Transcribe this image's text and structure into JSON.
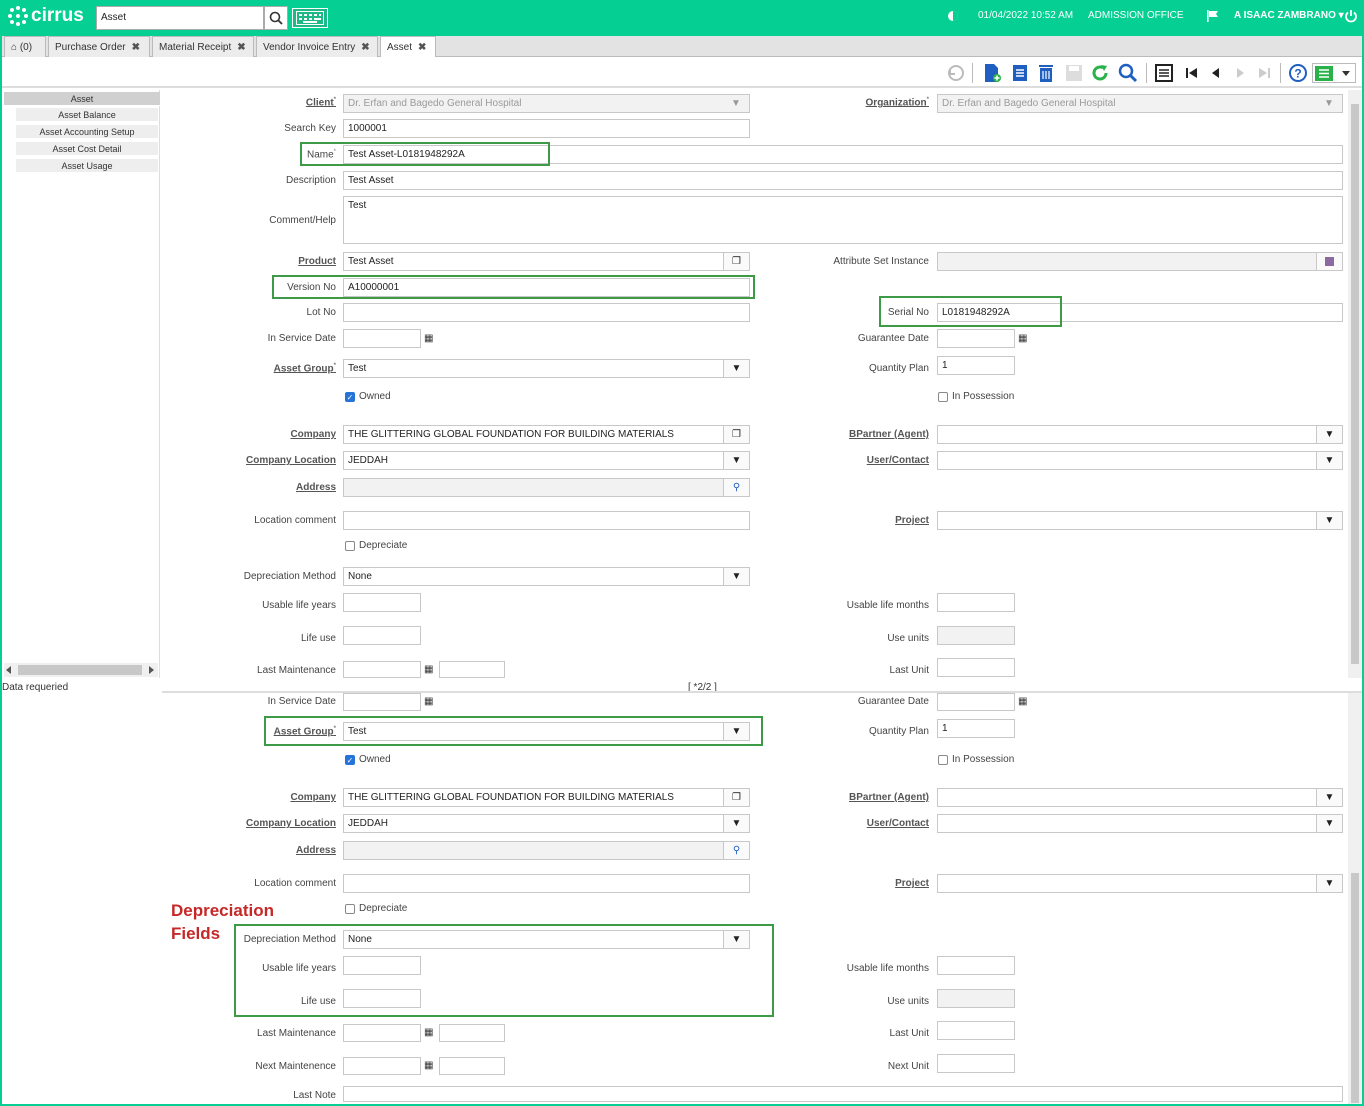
{
  "header": {
    "logo_text": "cirrus",
    "search_value": "Asset",
    "datetime": "01/04/2022 10:52 AM",
    "office": "ADMISSION OFFICE",
    "user": "A ISAAC ZAMBRANO ▾"
  },
  "tabs": [
    {
      "label": "(0)"
    },
    {
      "label": "Purchase Order"
    },
    {
      "label": "Material Receipt"
    },
    {
      "label": "Vendor Invoice Entry"
    },
    {
      "label": "Asset"
    }
  ],
  "nav": {
    "items": [
      {
        "label": "Asset"
      },
      {
        "label": "Asset Balance"
      },
      {
        "label": "Asset Accounting Setup"
      },
      {
        "label": "Asset Cost Detail"
      },
      {
        "label": "Asset Usage"
      }
    ],
    "status": "Data requeried",
    "record_info": "[ *2/2 ]"
  },
  "form": {
    "client_label": "Client",
    "client_value": "Dr. Erfan and Bagedo General Hospital",
    "org_label": "Organization",
    "org_value": "Dr. Erfan and Bagedo General Hospital",
    "search_key_label": "Search Key",
    "search_key_value": "1000001",
    "name_label": "Name",
    "name_value": "Test Asset-L0181948292A",
    "description_label": "Description",
    "description_value": "Test Asset",
    "comment_label": "Comment/Help",
    "comment_value": "Test",
    "product_label": "Product",
    "product_value": "Test Asset",
    "attr_set_label": "Attribute Set Instance",
    "version_label": "Version No",
    "version_value": "A10000001",
    "lot_label": "Lot No",
    "serial_label": "Serial No",
    "serial_value": "L0181948292A",
    "in_service_label": "In Service Date",
    "guarantee_label": "Guarantee Date",
    "asset_group_label": "Asset Group",
    "asset_group_value": "Test",
    "quantity_plan_label": "Quantity Plan",
    "quantity_plan_value": "1",
    "owned_label": "Owned",
    "in_possession_label": "In Possession",
    "company_label": "Company",
    "company_value": "THE GLITTERING GLOBAL FOUNDATION FOR BUILDING MATERIALS",
    "bpartner_label": "BPartner (Agent)",
    "company_location_label": "Company Location",
    "company_location_value": "JEDDAH",
    "user_contact_label": "User/Contact",
    "address_label": "Address",
    "location_comment_label": "Location comment",
    "project_label": "Project",
    "depreciate_label": "Depreciate",
    "depr_method_label": "Depreciation Method",
    "depr_method_value": "None",
    "usable_years_label": "Usable life years",
    "usable_months_label": "Usable life months",
    "life_use_label": "Life use",
    "use_units_label": "Use units",
    "last_maint_label": "Last Maintenance",
    "last_unit_label": "Last Unit",
    "next_maint_label": "Next Maintenence",
    "next_unit_label": "Next Unit",
    "last_note_label": "Last Note"
  },
  "annotation": {
    "depreciation_title": "Depreciation",
    "depreciation_subtitle": "Fields"
  },
  "colors": {
    "header_bg": "#05cf93",
    "highlight_border": "#3d9b47",
    "annotation_text": "#c62828",
    "checkbox_on": "#2673d9"
  }
}
